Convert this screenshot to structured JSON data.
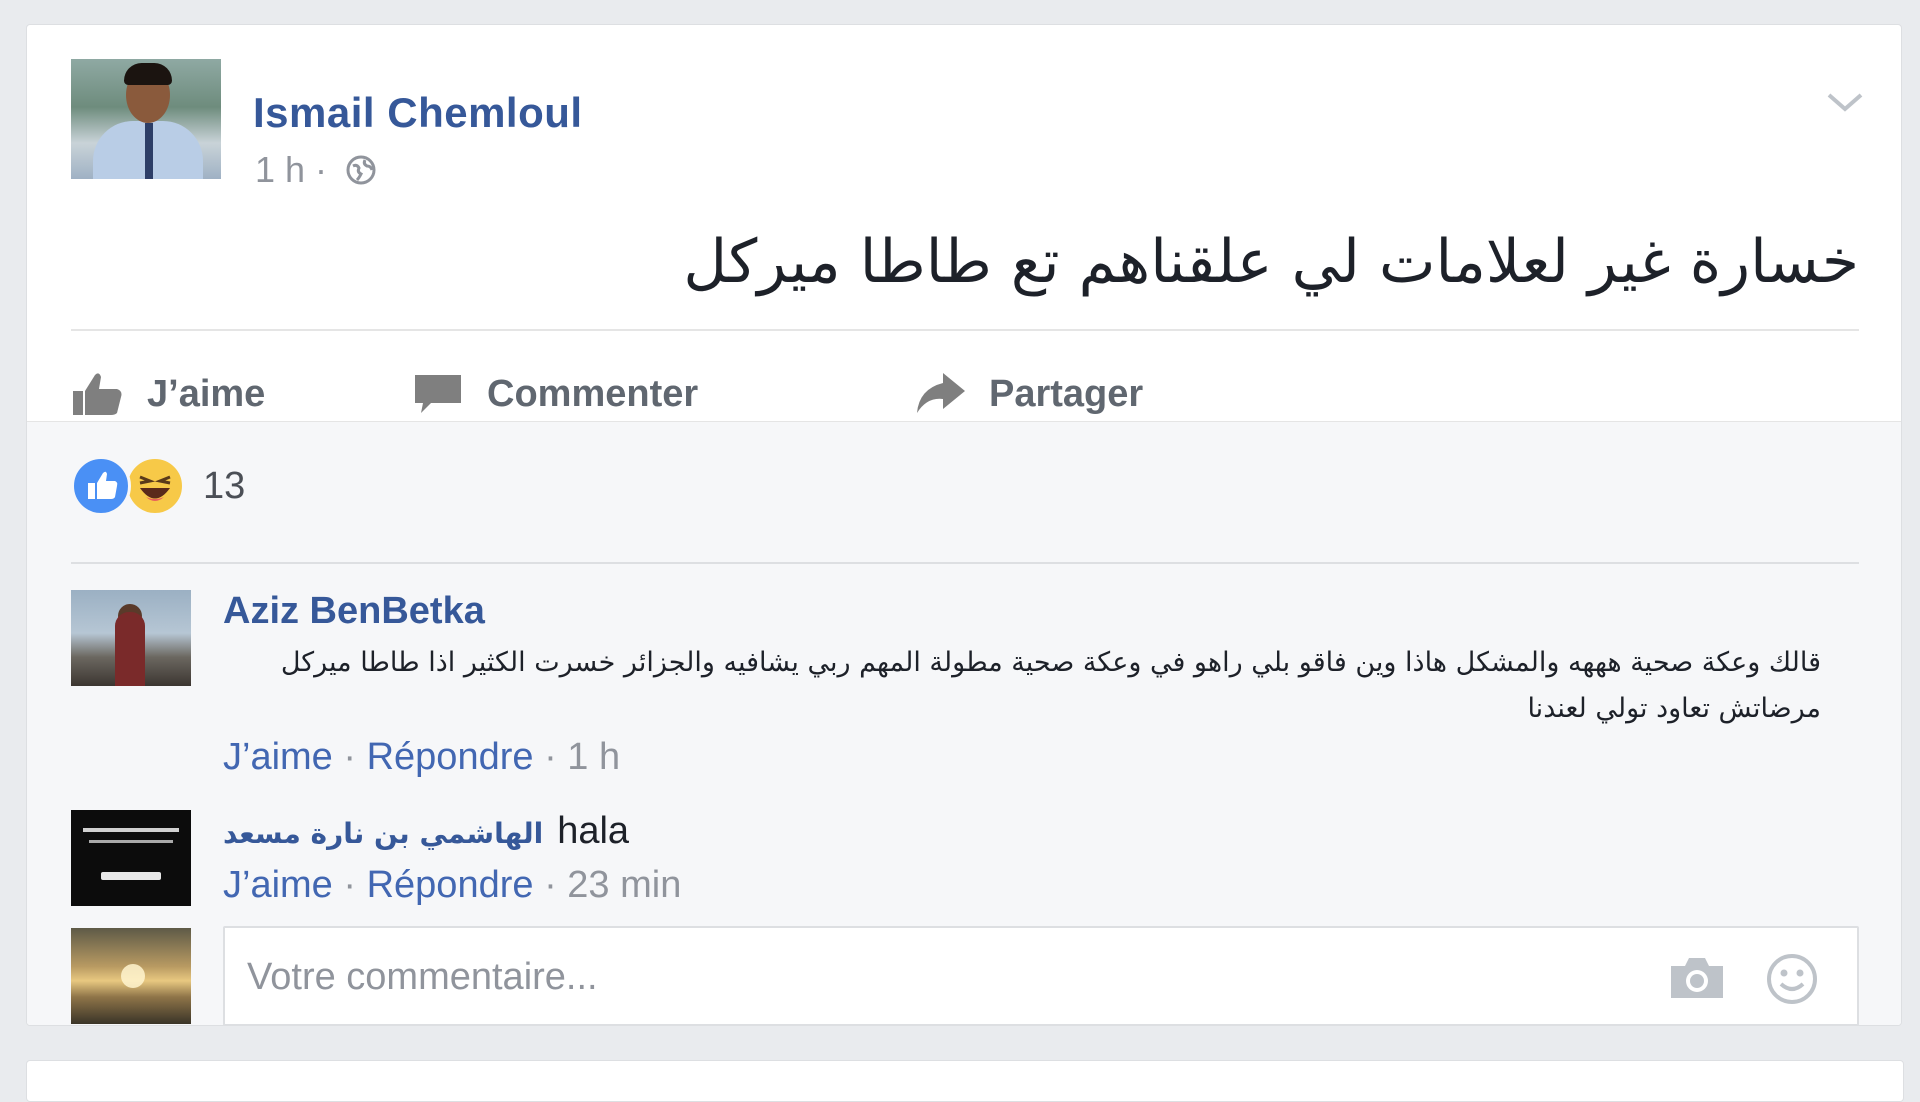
{
  "post": {
    "author": "Ismail Chemloul",
    "time": "1 h",
    "separator": "·",
    "text": "خسارة غير لعلامات لي علقناهم تع طاطا ميركل"
  },
  "actions": {
    "like": "J’aime",
    "comment": "Commenter",
    "share": "Partager"
  },
  "reactions": {
    "count": "13",
    "types": [
      "like",
      "haha"
    ]
  },
  "comments": [
    {
      "author": "Aziz BenBetka",
      "text": "قالك وعكة صحية هههه والمشكل هاذا وين فاقو بلي راهو في وعكة صحية مطولة المهم ربي يشافيه والجزائر خسرت الكثير اذا طاطا ميركل مرضاتش تعاود تولي لعندنا",
      "like": "J’aime",
      "reply": "Répondre",
      "time": "1 h"
    },
    {
      "author": "الهاشمي بن نارة مسعد",
      "text": "hala",
      "like": "J’aime",
      "reply": "Répondre",
      "time": "23 min"
    }
  ],
  "composer": {
    "placeholder": "Votre commentaire..."
  },
  "colors": {
    "link_blue": "#365899",
    "action_blue": "#4267b2",
    "meta_gray": "#90949c",
    "like_blue": "#4a90f5",
    "haha_yellow": "#f7c948"
  }
}
